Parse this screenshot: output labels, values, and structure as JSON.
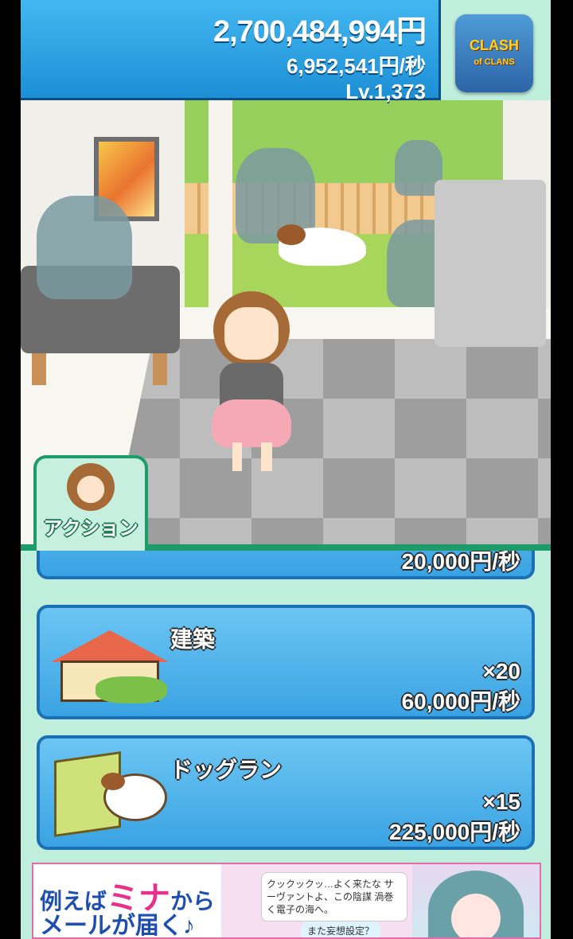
{
  "hud": {
    "money": "2,700,484,994円",
    "income_rate": "6,952,541円/秒",
    "level": "Lv.1,373"
  },
  "promo_app": {
    "label_line1": "CLASH",
    "label_line2": "of CLANS"
  },
  "action_tab": {
    "label": "アクション"
  },
  "upgrades": [
    {
      "name": "",
      "count": "",
      "income": "20,000円/秒"
    },
    {
      "name": "建築",
      "count": "×20",
      "income": "60,000円/秒"
    },
    {
      "name": "ドッグラン",
      "count": "×15",
      "income": "225,000円/秒"
    }
  ],
  "ad": {
    "line1_prefix": "例えば",
    "line1_highlight": "ミナ",
    "line1_suffix": "から",
    "line2": "メールが届く♪",
    "bubble": "クックックッ…よく来たな サーヴァントよ、この陰謀 渦巻く電子の海へ。",
    "bubble2": "また妄想設定？"
  },
  "colors": {
    "hud_blue": "#2a9fe6",
    "card_blue": "#3aa3e3",
    "tab_green": "#1f9a6a",
    "list_bg": "#bfeedd"
  }
}
